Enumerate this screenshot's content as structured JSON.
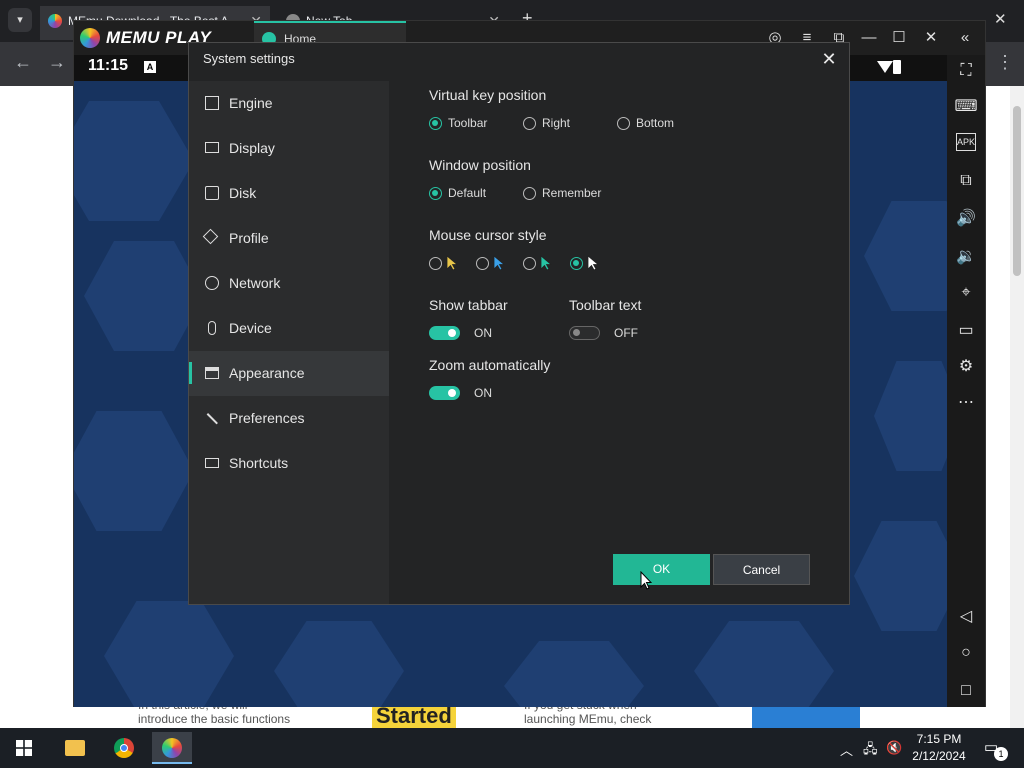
{
  "browser": {
    "tabs": [
      {
        "title": "MEmu Download - The Best A",
        "active": true
      },
      {
        "title": "New Tab",
        "active": false
      }
    ]
  },
  "background_page": {
    "snippet_left_line1": "In this article, we will",
    "snippet_left_line2": "introduce the basic functions",
    "snippet_started": "Started",
    "snippet_right_line1": "If you get stuck when",
    "snippet_right_line2": "launching MEmu, check"
  },
  "memu": {
    "logo_text": "MEMU PLAY",
    "home_tab": "Home",
    "android_time": "11:15",
    "android_a_badge": "A"
  },
  "dialog": {
    "title": "System settings",
    "sidebar": [
      {
        "label": "Engine",
        "icon": "chip-icon",
        "active": false
      },
      {
        "label": "Display",
        "icon": "monitor-icon",
        "active": false
      },
      {
        "label": "Disk",
        "icon": "disk-icon",
        "active": false
      },
      {
        "label": "Profile",
        "icon": "tag-icon",
        "active": false
      },
      {
        "label": "Network",
        "icon": "globe-icon",
        "active": false
      },
      {
        "label": "Device",
        "icon": "microphone-icon",
        "active": false
      },
      {
        "label": "Appearance",
        "icon": "window-icon",
        "active": true
      },
      {
        "label": "Preferences",
        "icon": "wrench-icon",
        "active": false
      },
      {
        "label": "Shortcuts",
        "icon": "keyboard-icon",
        "active": false
      }
    ],
    "virtual_key": {
      "label": "Virtual key position",
      "options": [
        "Toolbar",
        "Right",
        "Bottom"
      ],
      "selected": "Toolbar"
    },
    "window_position": {
      "label": "Window position",
      "options": [
        "Default",
        "Remember"
      ],
      "selected": "Default"
    },
    "mouse_cursor": {
      "label": "Mouse cursor style",
      "options": [
        "yellow-cursor",
        "blue-cursor",
        "teal-cursor",
        "white-cursor"
      ],
      "selected": "white-cursor"
    },
    "show_tabbar": {
      "label": "Show tabbar",
      "state": "ON"
    },
    "toolbar_text": {
      "label": "Toolbar text",
      "state": "OFF"
    },
    "zoom_auto": {
      "label": "Zoom automatically",
      "state": "ON"
    },
    "ok_label": "OK",
    "cancel_label": "Cancel"
  },
  "taskbar": {
    "time": "7:15 PM",
    "date": "2/12/2024",
    "notification_count": "1"
  },
  "colors": {
    "accent": "#27c3a4",
    "dialog_bg": "#232425",
    "sidebar_bg": "#2b2c2d",
    "android_bg": "#17335f"
  }
}
